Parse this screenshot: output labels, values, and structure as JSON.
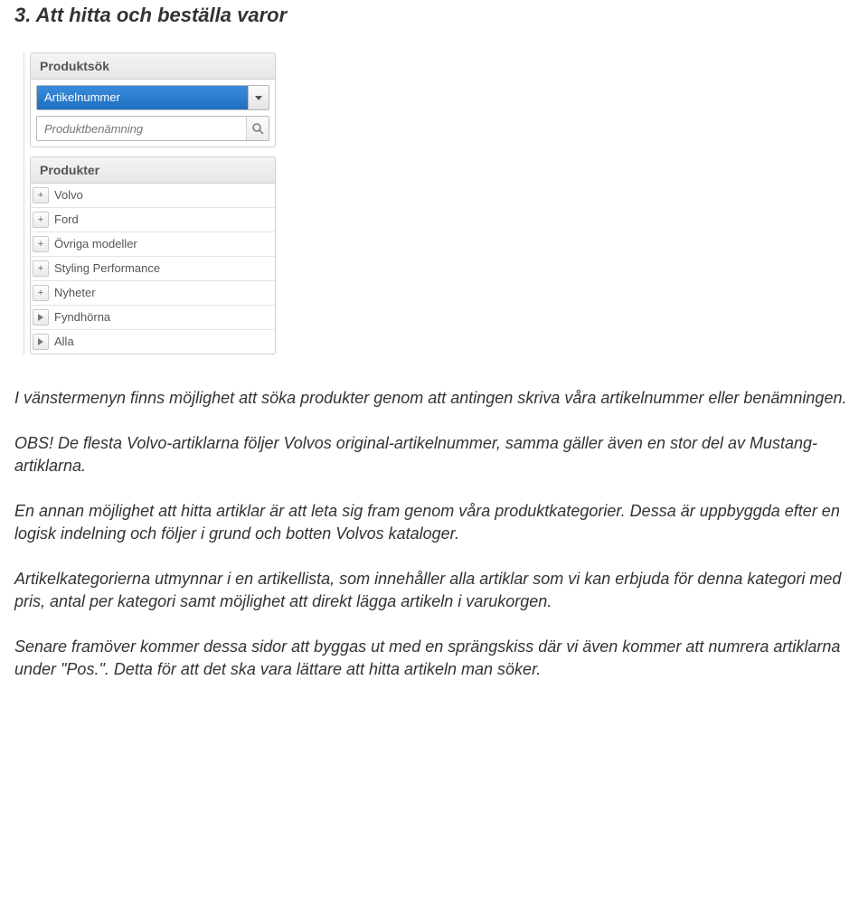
{
  "heading": "3. Att hitta och beställa varor",
  "sidebar": {
    "search_panel": {
      "title": "Produktsök",
      "combo_value": "Artikelnummer",
      "input_placeholder": "Produktbenämning"
    },
    "products_panel": {
      "title": "Produkter",
      "items": [
        {
          "icon": "plus",
          "label": "Volvo"
        },
        {
          "icon": "plus",
          "label": "Ford"
        },
        {
          "icon": "plus",
          "label": "Övriga modeller"
        },
        {
          "icon": "plus",
          "label": "Styling Performance"
        },
        {
          "icon": "plus",
          "label": "Nyheter"
        },
        {
          "icon": "chevron",
          "label": "Fyndhörna"
        },
        {
          "icon": "chevron",
          "label": "Alla"
        }
      ]
    }
  },
  "paragraphs": {
    "p1": "I vänstermenyn finns möjlighet att söka produkter genom att antingen skriva våra artikelnummer eller benämningen.",
    "p2": "OBS! De flesta Volvo-artiklarna följer Volvos original-artikelnummer, samma gäller även en stor del av Mustang-artiklarna.",
    "p3": "En annan möjlighet att hitta artiklar är att leta sig fram genom våra produktkategorier. Dessa är uppbyggda efter en logisk indelning och följer i grund och botten Volvos kataloger.",
    "p4": "Artikelkategorierna utmynnar i en artikellista, som innehåller alla artiklar som vi kan erbjuda för denna kategori med pris, antal per kategori samt möjlighet att direkt lägga artikeln i varukorgen.",
    "p5": "Senare framöver kommer dessa sidor att byggas ut med en sprängskiss där vi även kommer att numrera artiklarna under \"Pos.\". Detta för att det ska vara lättare att hitta artikeln man söker."
  }
}
